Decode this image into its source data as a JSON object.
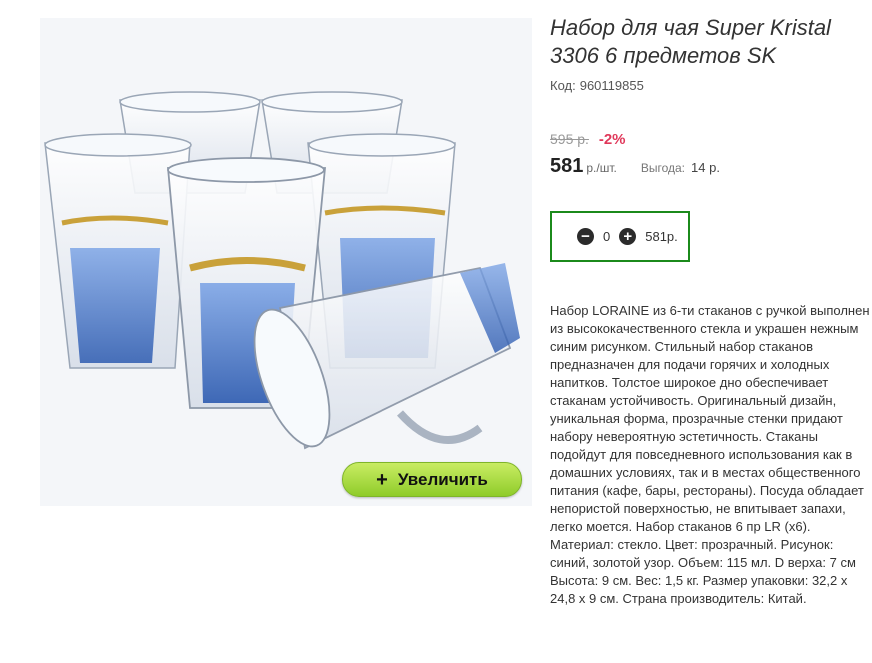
{
  "product": {
    "title": "Набор для чая Super Kristal 3306 6 предметов SK",
    "code_label": "Код:",
    "code": "960119855",
    "zoom_label": "Увеличить",
    "zoom_icon": "plus-icon"
  },
  "pricing": {
    "old_price": "595 р.",
    "discount": "-2%",
    "price": "581",
    "price_unit": "р./шт.",
    "saving_label": "Выгода:",
    "saving_value": "14 р."
  },
  "cart": {
    "minus_icon": "minus-circle-icon",
    "plus_icon": "plus-circle-icon",
    "quantity": "0",
    "total": "581р.",
    "border_color": "#1b8a1b"
  },
  "description": "Набор LORAINE из 6-ти стаканов с ручкой выполнен из высококачественного стекла и украшен нежным синим рисунком. Стильный набор стаканов предназначен для подачи горячих и холодных напитков. Толстое широкое дно обеспечивает стаканам устойчивость. Оригинальный дизайн, уникальная форма, прозрачные стенки придают набору невероятную эстетичность. Стаканы подойдут для повседневного использования как в домашних условиях, так и в местах общественного питания (кафе, бары, рестораны). Посуда обладает непористой поверхностью, не впитывает запахи, легко моется. Набор стаканов 6 пр LR (x6). Материал: стекло. Цвет: прозрачный. Рисунок: синий, золотой узор. Объем: 115 мл. D верха: 7 см Высота: 9 см. Вес: 1,5 кг. Размер упаковки: 32,2 х 24,8 х 9 см. Страна производитель: Китай.",
  "colors": {
    "discount": "#e0385a",
    "zoom_button": "#a8dc3c",
    "glass_blue": "#3a6fc0",
    "glass_gold": "#c9a13a"
  }
}
